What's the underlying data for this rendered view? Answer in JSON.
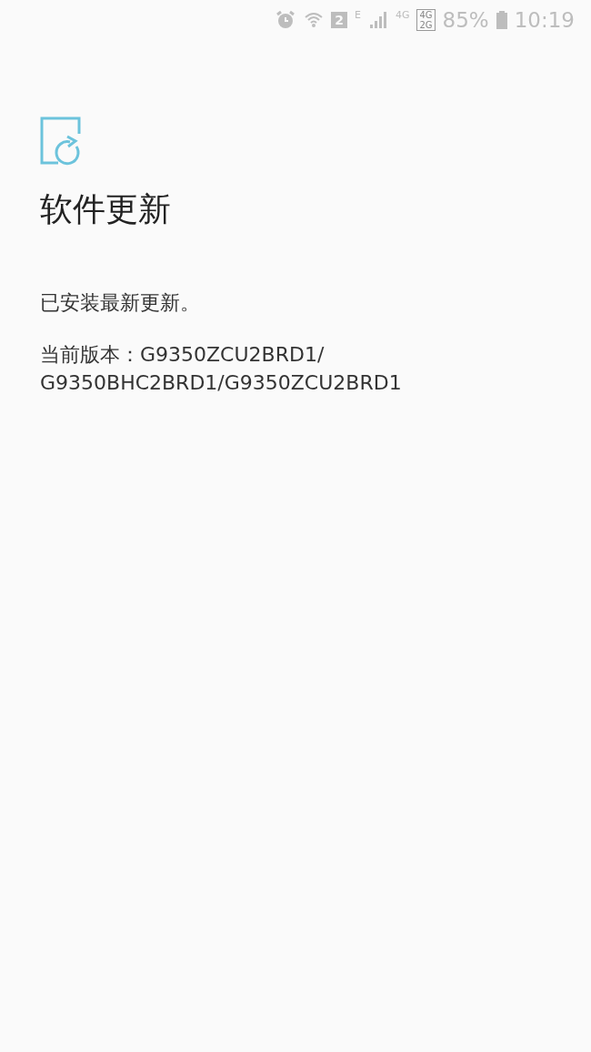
{
  "status_bar": {
    "sim_slot": "2",
    "network_type": "E",
    "mobile_data": "4G",
    "dual_network": [
      "4G",
      "2G"
    ],
    "battery": "85%",
    "time": "10:19"
  },
  "title": "软件更新",
  "message": "已安装最新更新。",
  "version": "当前版本：G9350ZCU2BRD1/G9350BHC2BRD1/G9350ZCU2BRD1"
}
